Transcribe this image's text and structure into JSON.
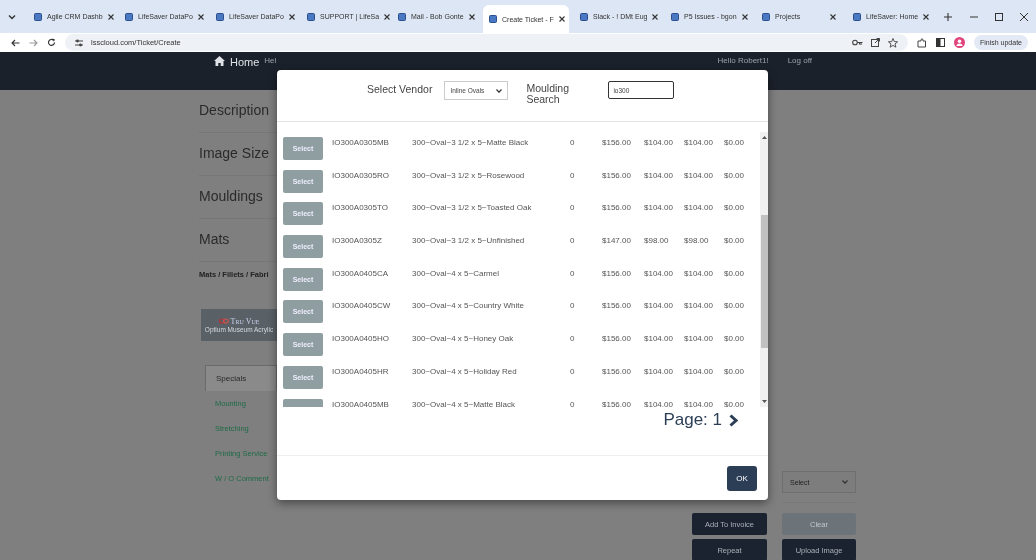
{
  "browser": {
    "tabs": [
      {
        "title": "Agile CRM Dashb",
        "selected": false
      },
      {
        "title": "LifeSaver DataPo",
        "selected": false
      },
      {
        "title": "LifeSaver DataPo",
        "selected": false
      },
      {
        "title": "SUPPORT | LifeSa",
        "selected": false
      },
      {
        "title": "Mail - Bob Gonte",
        "selected": false
      },
      {
        "title": "Create Ticket - F",
        "selected": true
      },
      {
        "title": "Slack - ! DMt Eug",
        "selected": false
      },
      {
        "title": "P5 Issues - bgon",
        "selected": false
      },
      {
        "title": "Projects",
        "selected": false
      },
      {
        "title": "LifeSaver: Home",
        "selected": false
      }
    ],
    "url": "lsscloud.com/Ticket/Create",
    "update_button": "Finish update"
  },
  "navbar": {
    "left": [
      "Home",
      "Hel"
    ],
    "right": [
      "Hello Robert1!",
      "Log off"
    ]
  },
  "page": {
    "sections": [
      "Description",
      "Image Size",
      "Mouldings",
      "Mats"
    ],
    "subheading": "Mats / Fillets / Fabri",
    "product_card": {
      "brand": "Tru Vue",
      "caption": "Optium Museum Acrylic"
    },
    "specials_tabs": [
      {
        "label": "Specials",
        "selected": true
      }
    ],
    "special_links": [
      "Mounting",
      "Stretching",
      "Printing Service",
      "W / O Comment"
    ],
    "select_value": "Select",
    "buttons": [
      {
        "label": "Add To Invoice",
        "kind": "primary"
      },
      {
        "label": "Clear",
        "kind": "disabled"
      },
      {
        "label": "Repeat",
        "kind": "primary"
      },
      {
        "label": "Upload Image",
        "kind": "primary"
      }
    ]
  },
  "modal": {
    "vendor_label": "Select Vendor",
    "vendor_value": "Inline Ovals",
    "search_label": "Moulding Search",
    "search_value": "io300",
    "rows": [
      {
        "button": "Select",
        "code": "IO300A0305MB",
        "description": "300~Oval~3 1/2 x 5~Matte Black",
        "cells": [
          "0",
          "$156.00",
          "$104.00",
          "$104.00",
          "$0.00"
        ]
      },
      {
        "button": "Select",
        "code": "IO300A0305RO",
        "description": "300~Oval~3 1/2 x 5~Rosewood",
        "cells": [
          "0",
          "$156.00",
          "$104.00",
          "$104.00",
          "$0.00"
        ]
      },
      {
        "button": "Select",
        "code": "IO300A0305TO",
        "description": "300~Oval~3 1/2 x 5~Toasted Oak",
        "cells": [
          "0",
          "$156.00",
          "$104.00",
          "$104.00",
          "$0.00"
        ]
      },
      {
        "button": "Select",
        "code": "IO300A0305Z",
        "description": "300~Oval~3 1/2 x 5~Unfinished",
        "cells": [
          "0",
          "$147.00",
          "$98.00",
          "$98.00",
          "$0.00"
        ]
      },
      {
        "button": "Select",
        "code": "IO300A0405CA",
        "description": "300~Oval~4 x 5~Carmel",
        "cells": [
          "0",
          "$156.00",
          "$104.00",
          "$104.00",
          "$0.00"
        ]
      },
      {
        "button": "Select",
        "code": "IO300A0405CW",
        "description": "300~Oval~4 x 5~Country White",
        "cells": [
          "0",
          "$156.00",
          "$104.00",
          "$104.00",
          "$0.00"
        ]
      },
      {
        "button": "Select",
        "code": "IO300A0405HO",
        "description": "300~Oval~4 x 5~Honey Oak",
        "cells": [
          "0",
          "$156.00",
          "$104.00",
          "$104.00",
          "$0.00"
        ]
      },
      {
        "button": "Select",
        "code": "IO300A0405HR",
        "description": "300~Oval~4 x 5~Holiday Red",
        "cells": [
          "0",
          "$156.00",
          "$104.00",
          "$104.00",
          "$0.00"
        ]
      },
      {
        "code": "IO300A0405MB",
        "description": "300~Oval~4 x 5~Matte Black",
        "cells": [
          "0",
          "$156.00",
          "$104.00",
          "$104.00",
          "$0.00"
        ]
      }
    ],
    "page_label": "Page: 1",
    "ok_button": "OK"
  }
}
